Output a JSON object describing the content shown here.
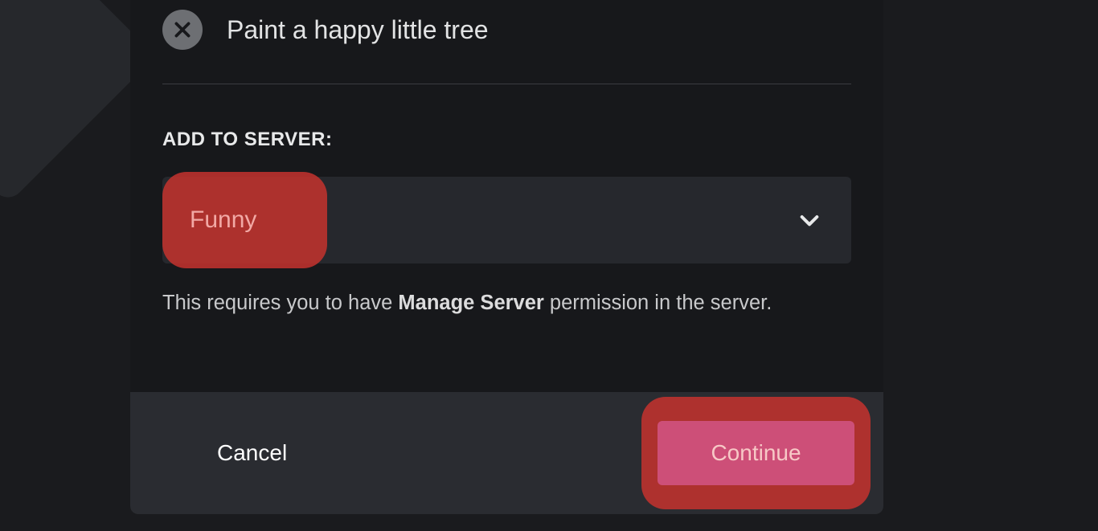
{
  "permission": {
    "denied_label": "Paint a happy little tree"
  },
  "section": {
    "label": "ADD TO SERVER:"
  },
  "select": {
    "value": "Funny"
  },
  "helper": {
    "prefix": "This requires you to have ",
    "strong": "Manage Server",
    "suffix": " permission in the server."
  },
  "footer": {
    "cancel": "Cancel",
    "continue": "Continue"
  }
}
